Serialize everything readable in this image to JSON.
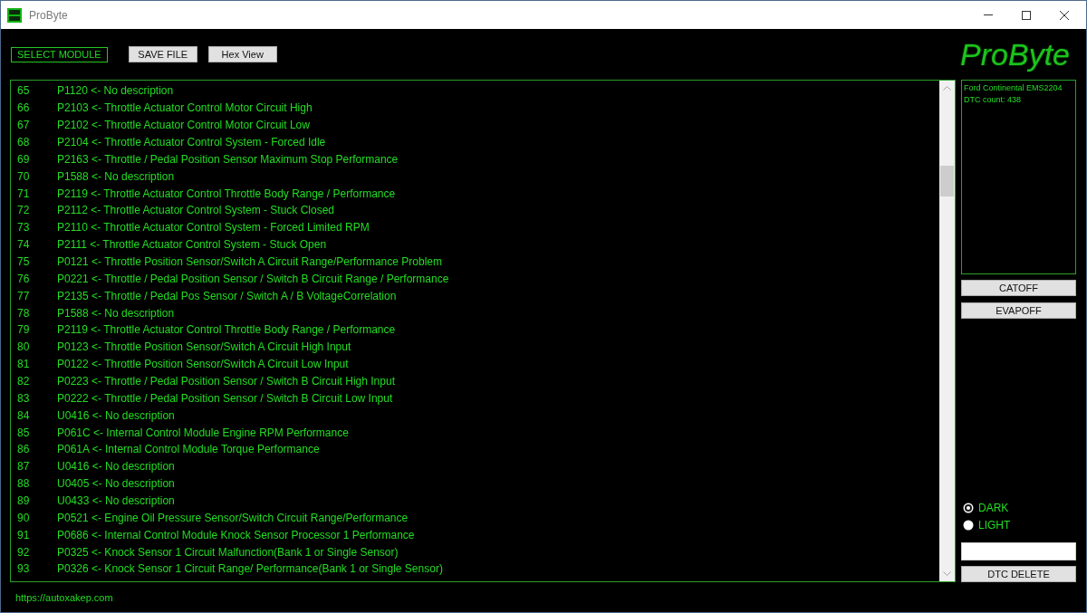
{
  "window": {
    "title": "ProByte"
  },
  "toolbar": {
    "module_label": "SELECT MODULE",
    "buttons": [
      "SAVE FILE",
      "Hex View"
    ]
  },
  "logo": {
    "text": "ProByte"
  },
  "dtc_list": {
    "rows": [
      {
        "number": "65",
        "entry": "P1120 <- No description"
      },
      {
        "number": "66",
        "entry": "P2103 <- Throttle Actuator Control Motor Circuit High"
      },
      {
        "number": "67",
        "entry": "P2102 <- Throttle Actuator Control Motor Circuit Low"
      },
      {
        "number": "68",
        "entry": "P2104 <- Throttle Actuator Control System - Forced Idle"
      },
      {
        "number": "69",
        "entry": "P2163 <- Throttle / Pedal Position Sensor Maximum Stop Performance"
      },
      {
        "number": "70",
        "entry": "P1588 <- No description"
      },
      {
        "number": "71",
        "entry": "P2119 <- Throttle Actuator Control Throttle Body Range / Performance"
      },
      {
        "number": "72",
        "entry": "P2112 <- Throttle Actuator Control System - Stuck Closed"
      },
      {
        "number": "73",
        "entry": "P2110 <- Throttle Actuator Control System - Forced Limited RPM"
      },
      {
        "number": "74",
        "entry": "P2111 <- Throttle Actuator Control System - Stuck Open"
      },
      {
        "number": "75",
        "entry": "P0121 <- Throttle Position Sensor/Switch A Circuit Range/Performance Problem"
      },
      {
        "number": "76",
        "entry": "P0221 <- Throttle / Pedal Position Sensor / Switch B Circuit Range / Performance"
      },
      {
        "number": "77",
        "entry": "P2135 <- Throttle / Pedal Pos Sensor / Switch A / B VoltageCorrelation"
      },
      {
        "number": "78",
        "entry": "P1588 <- No description"
      },
      {
        "number": "79",
        "entry": "P2119 <- Throttle Actuator Control Throttle Body Range / Performance"
      },
      {
        "number": "80",
        "entry": "P0123 <- Throttle Position Sensor/Switch A Circuit High Input"
      },
      {
        "number": "81",
        "entry": "P0122 <- Throttle Position Sensor/Switch A Circuit Low Input"
      },
      {
        "number": "82",
        "entry": "P0223 <- Throttle / Pedal Position Sensor / Switch B Circuit High Input"
      },
      {
        "number": "83",
        "entry": "P0222 <- Throttle / Pedal Position Sensor / Switch B Circuit Low Input"
      },
      {
        "number": "84",
        "entry": "U0416 <- No description"
      },
      {
        "number": "85",
        "entry": "P061C <- Internal Control Module Engine RPM Performance"
      },
      {
        "number": "86",
        "entry": "P061A <- Internal Control Module Torque Performance"
      },
      {
        "number": "87",
        "entry": "U0416 <- No description"
      },
      {
        "number": "88",
        "entry": "U0405 <- No description"
      },
      {
        "number": "89",
        "entry": "U0433 <- No description"
      },
      {
        "number": "90",
        "entry": "P0521 <- Engine Oil Pressure Sensor/Switch Circuit Range/Performance"
      },
      {
        "number": "91",
        "entry": "P0686 <- Internal Control Module Knock Sensor Processor 1 Performance"
      },
      {
        "number": "92",
        "entry": "P0325 <- Knock Sensor 1 Circuit Malfunction(Bank 1 or Single Sensor)"
      },
      {
        "number": "93",
        "entry": "P0326 <- Knock Sensor 1 Circuit Range/ Performance(Bank 1 or Single Sensor)"
      }
    ]
  },
  "info_panel": {
    "lines": [
      "Ford Continental EMS2204",
      "DTC count: 438"
    ]
  },
  "actions": {
    "buttons": [
      "CATOFF",
      "EVAPOFF"
    ]
  },
  "theme": {
    "options": [
      {
        "label": "DARK",
        "selected": true
      },
      {
        "label": "LIGHT",
        "selected": false
      }
    ]
  },
  "delete_button": {
    "label": "DTC DELETE"
  },
  "footer": {
    "link": "https://autoxakep.com"
  }
}
